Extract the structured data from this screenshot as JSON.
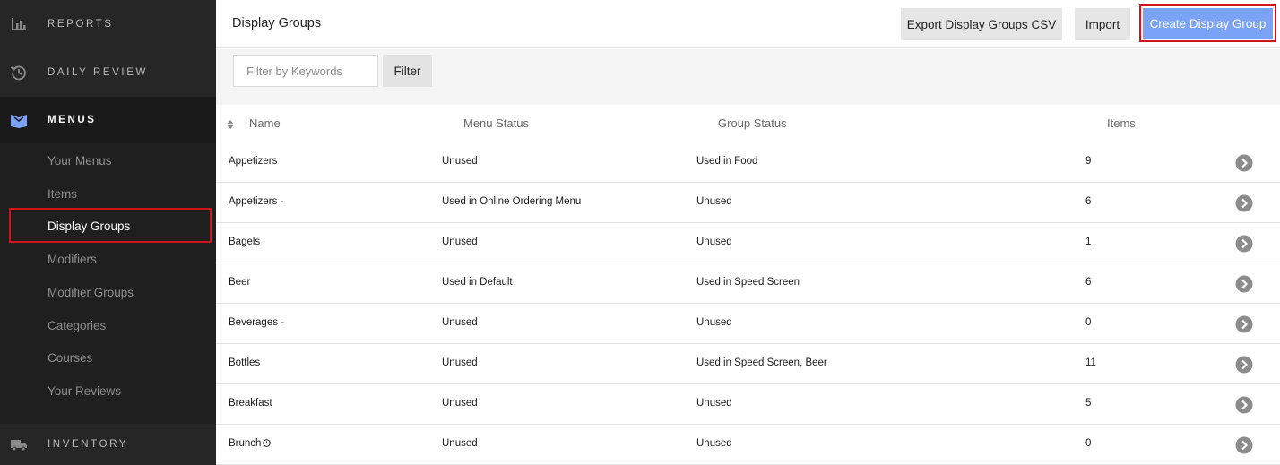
{
  "sidebar": {
    "sections": {
      "reports": "REPORTS",
      "daily_review": "DAILY REVIEW",
      "menus": "MENUS",
      "inventory": "INVENTORY"
    },
    "menus_items": [
      {
        "label": "Your Menus"
      },
      {
        "label": "Items"
      },
      {
        "label": "Display Groups"
      },
      {
        "label": "Modifiers"
      },
      {
        "label": "Modifier Groups"
      },
      {
        "label": "Categories"
      },
      {
        "label": "Courses"
      },
      {
        "label": "Your Reviews"
      }
    ],
    "active_item": "Display Groups"
  },
  "header": {
    "title": "Display Groups",
    "export_label": "Export Display Groups CSV",
    "import_label": "Import",
    "create_label": "Create Display Group"
  },
  "filter": {
    "placeholder": "Filter by Keywords",
    "button_label": "Filter"
  },
  "table": {
    "columns": [
      "Name",
      "Menu Status",
      "Group Status",
      "Items"
    ],
    "rows": [
      {
        "name": "Appetizers",
        "menu_status": "Unused",
        "group_status": "Used in Food",
        "items": "9"
      },
      {
        "name": "Appetizers -",
        "menu_status": "Used in Online Ordering Menu",
        "group_status": "Unused",
        "items": "6"
      },
      {
        "name": "Bagels",
        "menu_status": "Unused",
        "group_status": "Unused",
        "items": "1"
      },
      {
        "name": "Beer",
        "menu_status": "Used in Default",
        "group_status": "Used in Speed Screen",
        "items": "6"
      },
      {
        "name": "Beverages -",
        "menu_status": "Unused",
        "group_status": "Unused",
        "items": "0"
      },
      {
        "name": "Bottles",
        "menu_status": "Unused",
        "group_status": "Used in Speed Screen, Beer",
        "items": "11"
      },
      {
        "name": "Breakfast",
        "menu_status": "Unused",
        "group_status": "Unused",
        "items": "5"
      },
      {
        "name": "Brunch",
        "menu_status": "Unused",
        "group_status": "Unused",
        "items": "0",
        "icon": "clock-icon"
      }
    ]
  },
  "colors": {
    "sidebar_bg": "#1f1f1f",
    "accent_blue": "#7aa2f7",
    "highlight_red": "#d0141a"
  }
}
